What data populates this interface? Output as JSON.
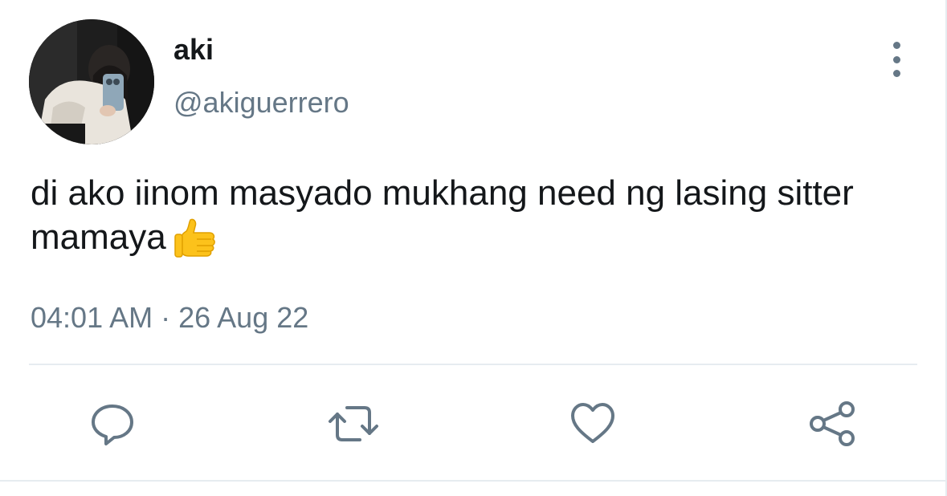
{
  "user": {
    "display_name": "aki",
    "handle": "@akiguerrero",
    "avatar": "profile-photo"
  },
  "tweet": {
    "text": "di ako iinom masyado mukhang need ng lasing sitter mamaya",
    "emoji": "thumbs-up-emoji",
    "timestamp": "04:01 AM · 26 Aug 22"
  },
  "actions": [
    {
      "icon": "reply-icon"
    },
    {
      "icon": "retweet-icon"
    },
    {
      "icon": "like-icon"
    },
    {
      "icon": "share-icon"
    }
  ],
  "menu": {
    "icon": "more-options-icon"
  },
  "colors": {
    "text_primary": "#14171a",
    "text_secondary": "#657786",
    "divider": "#e6ecf0",
    "emoji_yellow": "#fcc21b"
  }
}
